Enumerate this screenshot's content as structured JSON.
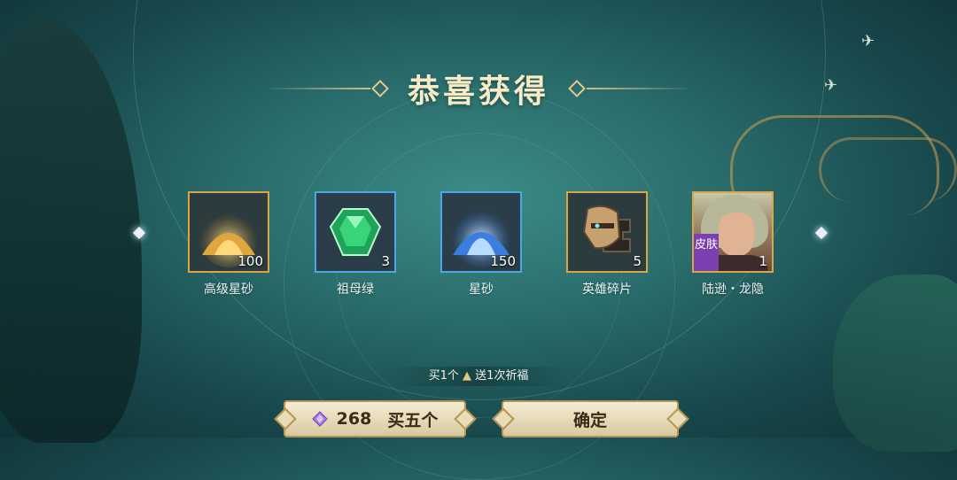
{
  "dialog": {
    "title": "恭喜获得"
  },
  "rewards": [
    {
      "name": "高级星砂",
      "count": "100",
      "frame": "gold",
      "icon": "gold-sand-icon"
    },
    {
      "name": "祖母绿",
      "count": "3",
      "frame": "blue",
      "icon": "emerald-icon"
    },
    {
      "name": "星砂",
      "count": "150",
      "frame": "blue",
      "icon": "star-sand-icon"
    },
    {
      "name": "英雄碎片",
      "count": "5",
      "frame": "gold",
      "icon": "hero-fragment-icon"
    },
    {
      "name": "陆逊・龙隐",
      "count": "1",
      "frame": "gold",
      "icon": "hero-portrait",
      "badge": "皮肤"
    }
  ],
  "promo": {
    "text_before": "买1个",
    "text_after": "送1次祈福"
  },
  "buttons": {
    "buy": {
      "price": "268",
      "label": "买五个"
    },
    "confirm": {
      "label": "确定"
    }
  },
  "colors": {
    "gold_frame": "#d9a548",
    "blue_frame": "#4aa7e8",
    "skin_badge": "#7b3fb0"
  }
}
